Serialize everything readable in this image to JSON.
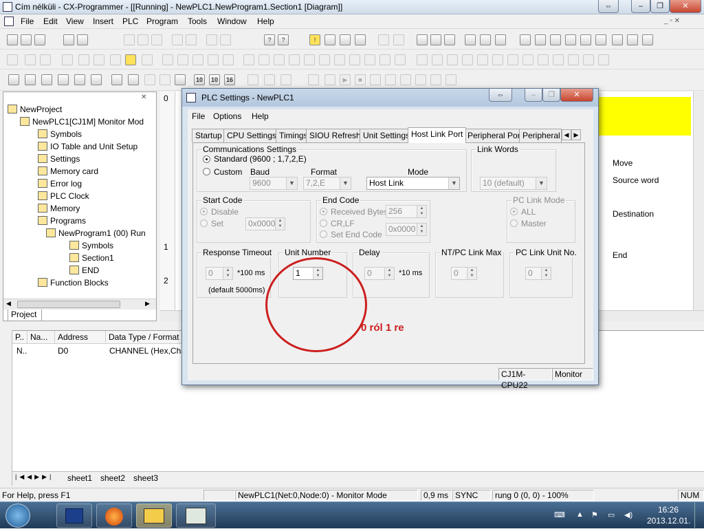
{
  "window": {
    "title": "Cím nélküli - CX-Programmer - [[Running] - NewPLC1.NewProgram1.Section1 [Diagram]]"
  },
  "menu": [
    "File",
    "Edit",
    "View",
    "Insert",
    "PLC",
    "Program",
    "Tools",
    "Window",
    "Help"
  ],
  "project": {
    "tab": "Project",
    "tree": [
      {
        "label": "NewProject",
        "level": 0,
        "icon": "project-icon"
      },
      {
        "label": "NewPLC1[CJ1M] Monitor Mod",
        "level": 1,
        "icon": "plc-icon"
      },
      {
        "label": "Symbols",
        "level": 2,
        "icon": "symbols-icon"
      },
      {
        "label": "IO Table and Unit Setup",
        "level": 2,
        "icon": "io-table-icon"
      },
      {
        "label": "Settings",
        "level": 2,
        "icon": "settings-icon"
      },
      {
        "label": "Memory card",
        "level": 2,
        "icon": "memory-card-icon"
      },
      {
        "label": "Error log",
        "level": 2,
        "icon": "error-log-icon"
      },
      {
        "label": "PLC Clock",
        "level": 2,
        "icon": "clock-icon"
      },
      {
        "label": "Memory",
        "level": 2,
        "icon": "memory-icon"
      },
      {
        "label": "Programs",
        "level": 2,
        "icon": "programs-icon"
      },
      {
        "label": "NewProgram1 (00) Run",
        "level": 3,
        "icon": "program-icon"
      },
      {
        "label": "Symbols",
        "level": 4,
        "icon": "symbols-icon"
      },
      {
        "label": "Section1",
        "level": 4,
        "icon": "section-icon"
      },
      {
        "label": "END",
        "level": 4,
        "icon": "section-icon"
      },
      {
        "label": "Function Blocks",
        "level": 2,
        "icon": "function-blocks-icon"
      }
    ]
  },
  "ladder": {
    "rungs": [
      "0",
      "1",
      "2"
    ],
    "comments": [
      "Move",
      "Source word",
      "Destination",
      "End"
    ]
  },
  "watch": {
    "columns": [
      "P..",
      "Na...",
      "Address",
      "Data Type / Format"
    ],
    "rows": [
      {
        "p": "N..",
        "name": "",
        "address": "D0",
        "type": "CHANNEL (Hex,Cha"
      }
    ],
    "sheets": [
      "sheet1",
      "sheet2",
      "sheet3"
    ]
  },
  "statusbar": {
    "help": "For Help, press F1",
    "connection": "NewPLC1(Net:0,Node:0) - Monitor Mode",
    "time": "0,9 ms",
    "sync": "SYNC",
    "rung": "rung 0 (0, 0)  - 100%",
    "num": "NUM"
  },
  "taskbar": {
    "time": "16:26",
    "date": "2013.12.01."
  },
  "dialog": {
    "title": "PLC Settings - NewPLC1",
    "menu": [
      "File",
      "Options",
      "Help"
    ],
    "tabs": [
      "Startup",
      "CPU Settings",
      "Timings",
      "SIOU Refresh",
      "Unit Settings",
      "Host Link Port",
      "Peripheral Port",
      "Peripheral S"
    ],
    "active_tab": "Host Link Port",
    "comm": {
      "title": "Communications Settings",
      "standard": "Standard (9600 ; 1,7,2,E)",
      "custom": "Custom",
      "baud_label": "Baud",
      "baud": "9600",
      "format_label": "Format",
      "format": "7,2,E",
      "mode_label": "Mode",
      "mode": "Host Link"
    },
    "link_words": {
      "title": "Link Words",
      "value": "10 (default)"
    },
    "start_code": {
      "title": "Start Code",
      "disable": "Disable",
      "set": "Set",
      "value": "0x0000"
    },
    "end_code": {
      "title": "End Code",
      "received": "Received Bytes",
      "received_value": "256",
      "crlf": "CR,LF",
      "set_end": "Set End Code",
      "value": "0x0000"
    },
    "pc_link_mode": {
      "title": "PC Link Mode",
      "all": "ALL",
      "master": "Master"
    },
    "response_timeout": {
      "title": "Response Timeout",
      "value": "0",
      "unit": "*100 ms",
      "default": "(default 5000ms)"
    },
    "unit_number": {
      "title": "Unit Number",
      "value": "1"
    },
    "delay": {
      "title": "Delay",
      "value": "0",
      "unit": "*10 ms"
    },
    "nt_pc_link": {
      "title": "NT/PC Link Max",
      "value": "0"
    },
    "pc_link_unit": {
      "title": "PC Link Unit No.",
      "value": "0"
    },
    "annotation": "0 ról 1 re",
    "status": {
      "cpu": "CJ1M-CPU22",
      "mode": "Monitor"
    }
  },
  "colors": {
    "annotation": "#cc1f1f",
    "ladder_highlight": "#ffff00",
    "taskbar": "#2a4a6e"
  }
}
